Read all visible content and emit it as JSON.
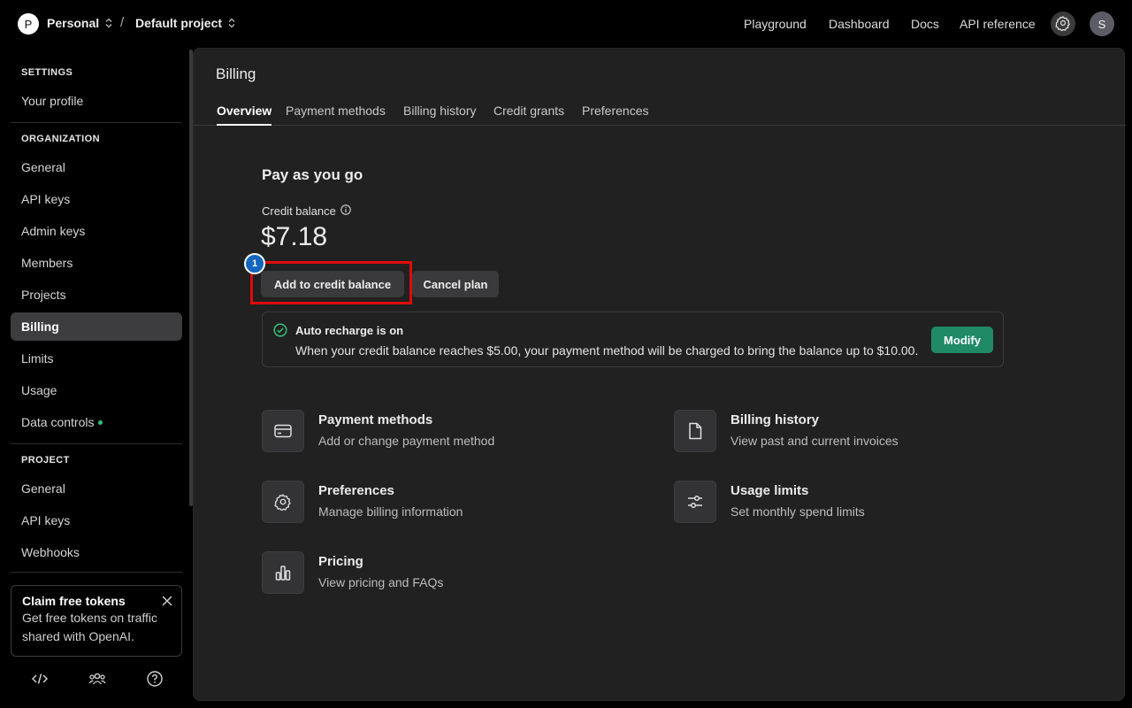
{
  "topbar": {
    "org_initial": "P",
    "org_name": "Personal",
    "separator": "/",
    "project_name": "Default project",
    "nav": [
      "Playground",
      "Dashboard",
      "Docs",
      "API reference"
    ],
    "user_initial": "S"
  },
  "sidebar": {
    "settings_heading": "SETTINGS",
    "settings_items": [
      "Your profile"
    ],
    "org_heading": "ORGANIZATION",
    "org_items": [
      "General",
      "API keys",
      "Admin keys",
      "Members",
      "Projects",
      "Billing",
      "Limits",
      "Usage",
      "Data controls"
    ],
    "active_item": "Billing",
    "project_heading": "PROJECT",
    "project_items": [
      "General",
      "API keys",
      "Webhooks"
    ],
    "promo": {
      "title": "Claim free tokens",
      "text": "Get free tokens on traffic shared with OpenAI."
    }
  },
  "main": {
    "title": "Billing",
    "tabs": [
      "Overview",
      "Payment methods",
      "Billing history",
      "Credit grants",
      "Preferences"
    ],
    "active_tab": "Overview",
    "plan_title": "Pay as you go",
    "balance_label": "Credit balance",
    "balance_value": "$7.18",
    "add_button": "Add to credit balance",
    "cancel_button": "Cancel plan",
    "marker_number": "1",
    "recharge": {
      "title": "Auto recharge is on",
      "description": "When your credit balance reaches $5.00, your payment method will be charged to bring the balance up to $10.00.",
      "modify_button": "Modify"
    },
    "cards": [
      {
        "title": "Payment methods",
        "subtitle": "Add or change payment method",
        "icon": "credit-card-icon"
      },
      {
        "title": "Billing history",
        "subtitle": "View past and current invoices",
        "icon": "document-icon"
      },
      {
        "title": "Preferences",
        "subtitle": "Manage billing information",
        "icon": "gear-icon"
      },
      {
        "title": "Usage limits",
        "subtitle": "Set monthly spend limits",
        "icon": "sliders-icon"
      },
      {
        "title": "Pricing",
        "subtitle": "View pricing and FAQs",
        "icon": "bar-chart-icon"
      }
    ]
  },
  "colors": {
    "accent_green": "#1f8a65",
    "highlight_red": "#e00a0a",
    "marker_blue": "#1565c0"
  }
}
